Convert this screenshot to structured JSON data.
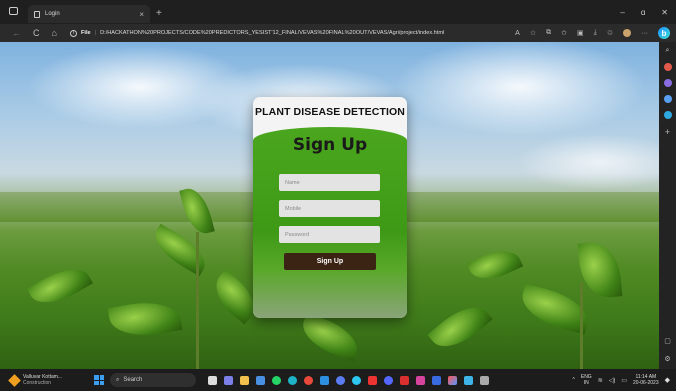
{
  "browser": {
    "tab_title": "Login",
    "tab_close": "×",
    "new_tab": "+",
    "nav": {
      "back": "←",
      "refresh": "C",
      "home": "⌂"
    },
    "address": {
      "scheme_label": "File",
      "url": "D:/HACKATHON%20PROJECTS/CODE%20PREDICTORS_YESIST'12_FINAL/VEVAS%20FINAL%20OUT/VEVAS/Agri/project/index.html"
    },
    "window_controls": {
      "minimize": "–",
      "restore": "ɑ",
      "close": "✕"
    }
  },
  "card": {
    "app_title": "PLANT DISEASE DETECTION",
    "heading": "Sign Up",
    "fields": {
      "name_placeholder": "Name",
      "mobile_placeholder": "Mobile",
      "password_placeholder": "Password"
    },
    "submit_label": "Sign Up"
  },
  "taskbar": {
    "weather": {
      "temp": "Valluvar Kottam...",
      "condition": "Construction"
    },
    "search_label": "Search",
    "tray": {
      "lang_line1": "ENG",
      "lang_line2": "IN",
      "time": "11:14 AM",
      "date": "20-06-2023"
    }
  },
  "colors": {
    "card_green": "#3e9a16",
    "button_brown": "#3b2414",
    "input_bg": "#e3e3e3",
    "chrome_dark": "#1f1f1f"
  }
}
